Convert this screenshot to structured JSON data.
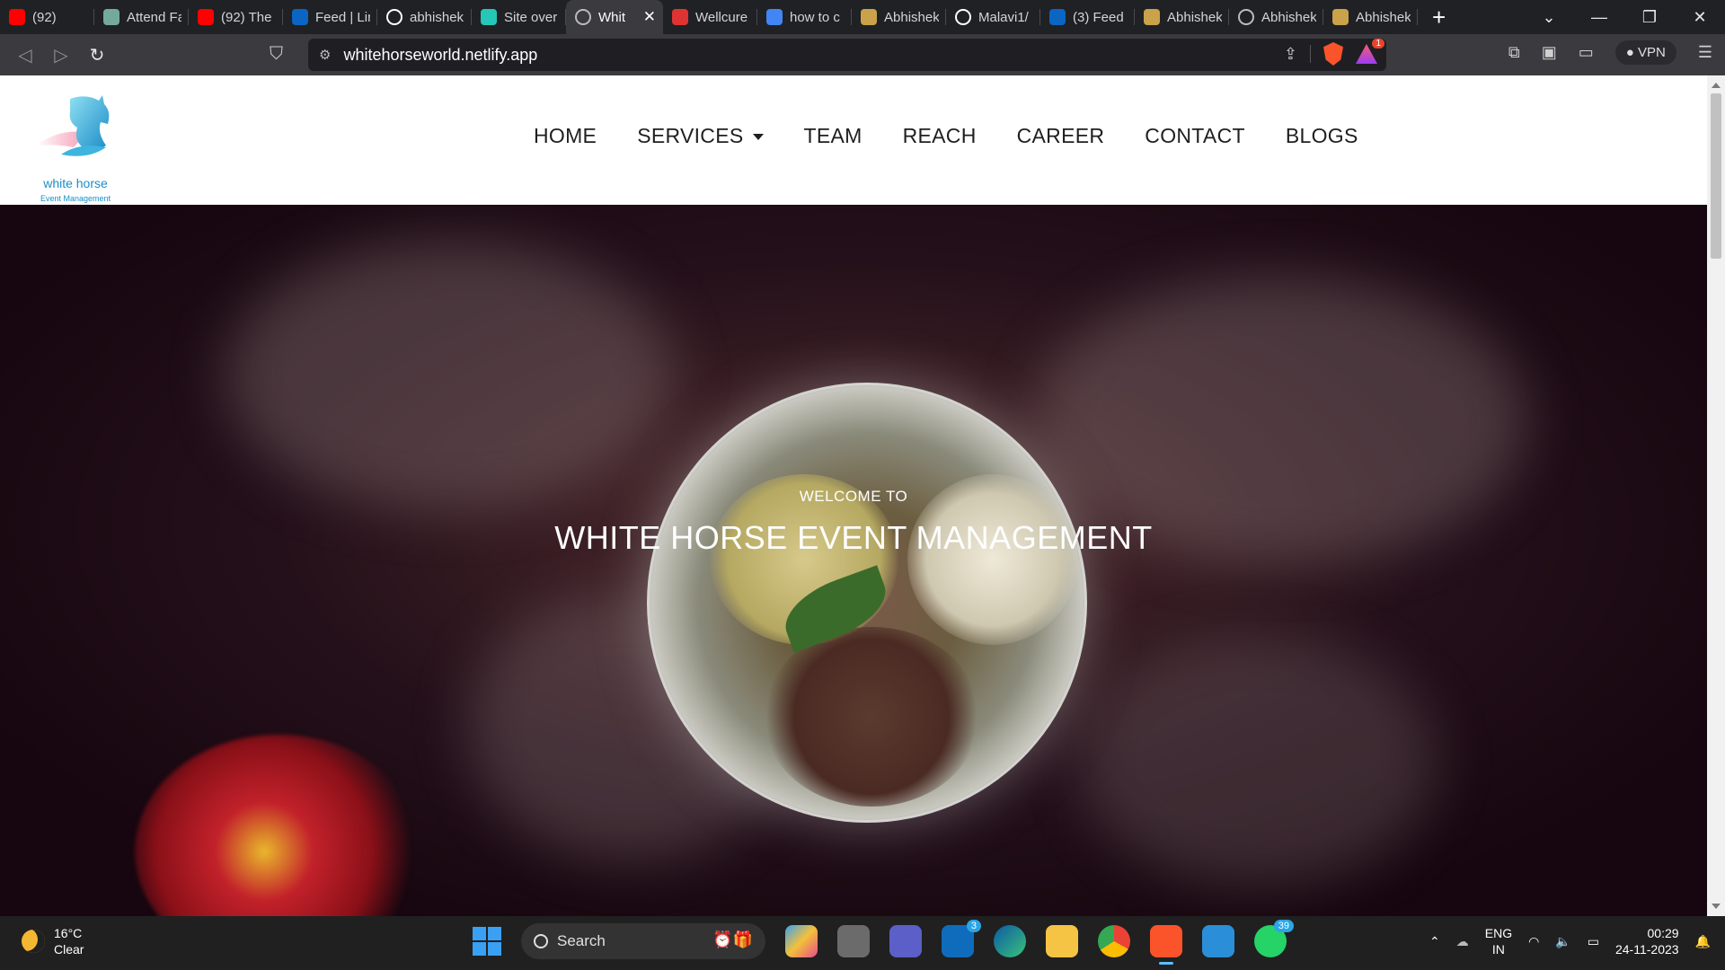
{
  "browser": {
    "tabs": [
      {
        "title": "(92)",
        "icon": "youtube-icon",
        "color": "#ff0000"
      },
      {
        "title": "Attend Fa",
        "icon": "chatgpt-icon",
        "color": "#74aa9c"
      },
      {
        "title": "(92) The",
        "icon": "youtube-icon",
        "color": "#ff0000"
      },
      {
        "title": "Feed | Lin",
        "icon": "linkedin-icon",
        "color": "#0a66c2"
      },
      {
        "title": "abhishek",
        "icon": "github-icon",
        "color": "#ffffff"
      },
      {
        "title": "Site over",
        "icon": "netlify-icon",
        "color": "#25c7b7"
      },
      {
        "title": "Whit",
        "icon": "globe-icon",
        "color": "#bbbbbb",
        "active": true
      },
      {
        "title": "Wellcure",
        "icon": "wellcure-icon",
        "color": "#d33"
      },
      {
        "title": "how to c",
        "icon": "google-icon",
        "color": "#4285f4"
      },
      {
        "title": "Abhishek",
        "icon": "profile-icon",
        "color": "#c9a24a"
      },
      {
        "title": "Malavi1/",
        "icon": "github-icon",
        "color": "#ffffff"
      },
      {
        "title": "(3) Feed",
        "icon": "linkedin-icon",
        "color": "#0a66c2"
      },
      {
        "title": "Abhishek",
        "icon": "profile-icon",
        "color": "#c9a24a"
      },
      {
        "title": "Abhishek",
        "icon": "globe-icon",
        "color": "#bbbbbb"
      },
      {
        "title": "Abhishek",
        "icon": "profile-icon",
        "color": "#c9a24a"
      }
    ],
    "url": "whitehorseworld.netlify.app",
    "vpn_label": "VPN",
    "rewards_badge": "1"
  },
  "site": {
    "logo_text": "white horse",
    "logo_sub": "Event Management",
    "nav": [
      {
        "label": "HOME"
      },
      {
        "label": "SERVICES",
        "dropdown": true
      },
      {
        "label": "TEAM"
      },
      {
        "label": "REACH"
      },
      {
        "label": "CAREER"
      },
      {
        "label": "CONTACT"
      },
      {
        "label": "BLOGS"
      }
    ],
    "hero": {
      "welcome": "WELCOME TO",
      "title": "WHITE HORSE EVENT MANAGEMENT"
    }
  },
  "taskbar": {
    "weather_temp": "16°C",
    "weather_desc": "Clear",
    "search_label": "Search",
    "apps": [
      {
        "name": "copilot-icon",
        "badge": ""
      },
      {
        "name": "task-view-icon",
        "badge": ""
      },
      {
        "name": "teams-icon",
        "badge": ""
      },
      {
        "name": "mail-icon",
        "badge": "3"
      },
      {
        "name": "edge-icon",
        "badge": ""
      },
      {
        "name": "file-explorer-icon",
        "badge": ""
      },
      {
        "name": "chrome-icon",
        "badge": ""
      },
      {
        "name": "brave-icon",
        "badge": ""
      },
      {
        "name": "vscode-icon",
        "badge": ""
      },
      {
        "name": "whatsapp-icon",
        "badge": "39"
      }
    ],
    "lang_top": "ENG",
    "lang_bottom": "IN",
    "time": "00:29",
    "date": "24-11-2023"
  }
}
